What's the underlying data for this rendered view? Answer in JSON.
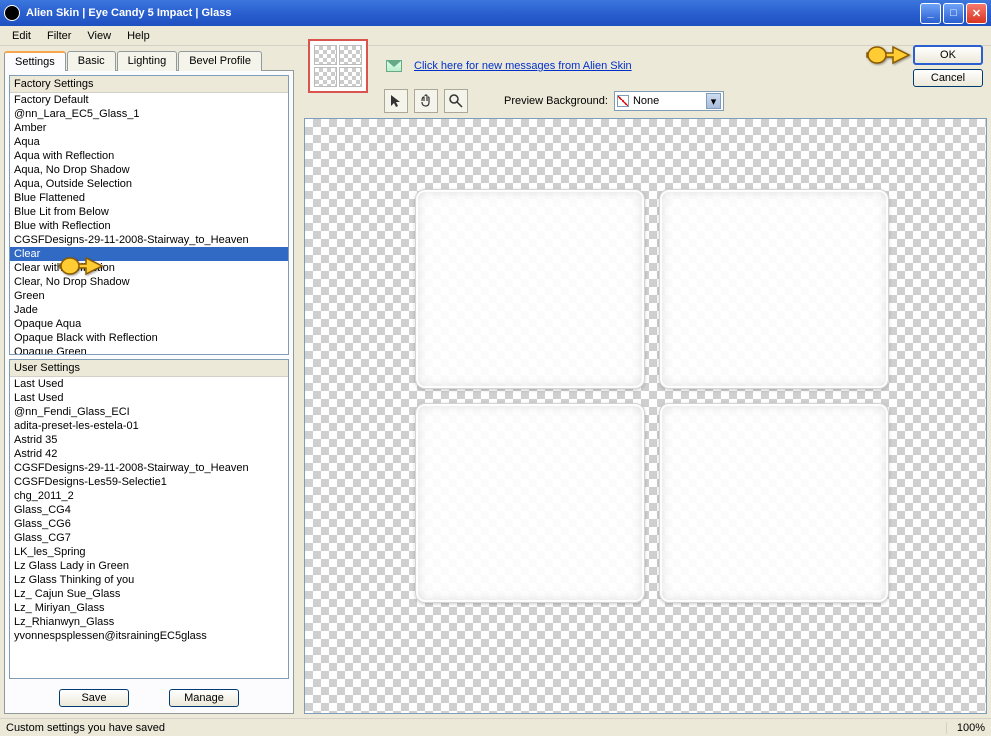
{
  "title": "Alien Skin  |  Eye Candy 5 Impact  |  Glass",
  "menubar": [
    "Edit",
    "Filter",
    "View",
    "Help"
  ],
  "tabs": [
    "Settings",
    "Basic",
    "Lighting",
    "Bevel Profile"
  ],
  "active_tab": 0,
  "factory_header": "Factory Settings",
  "factory_items": [
    "Factory Default",
    "@nn_Lara_EC5_Glass_1",
    "Amber",
    "Aqua",
    "Aqua with Reflection",
    "Aqua, No Drop Shadow",
    "Aqua, Outside Selection",
    "Blue Flattened",
    "Blue Lit from Below",
    "Blue with Reflection",
    "CGSFDesigns-29-11-2008-Stairway_to_Heaven",
    "Clear",
    "Clear with Reflection",
    "Clear, No Drop Shadow",
    "Green",
    "Jade",
    "Opaque Aqua",
    "Opaque Black with Reflection",
    "Opaque Green"
  ],
  "factory_selected_index": 11,
  "user_header": "User Settings",
  "user_items": [
    "Last Used",
    "Last Used",
    "@nn_Fendi_Glass_ECI",
    "adita-preset-les-estela-01",
    "Astrid 35",
    "Astrid 42",
    "CGSFDesigns-29-11-2008-Stairway_to_Heaven",
    "CGSFDesigns-Les59-Selectie1",
    "chg_2011_2",
    "Glass_CG4",
    "Glass_CG6",
    "Glass_CG7",
    "LK_les_Spring",
    "Lz Glass Lady in Green",
    "Lz Glass Thinking of you",
    "Lz_ Cajun Sue_Glass",
    "Lz_ Miriyan_Glass",
    "Lz_Rhianwyn_Glass",
    "yvonnespsplessen@itsrainingEC5glass"
  ],
  "buttons": {
    "save": "Save",
    "manage": "Manage",
    "ok": "OK",
    "cancel": "Cancel"
  },
  "link_text": "Click here for new messages from Alien Skin",
  "preview_bg_label": "Preview Background:",
  "preview_bg_value": "None",
  "status_text": "Custom settings you have saved",
  "zoom": "100%"
}
